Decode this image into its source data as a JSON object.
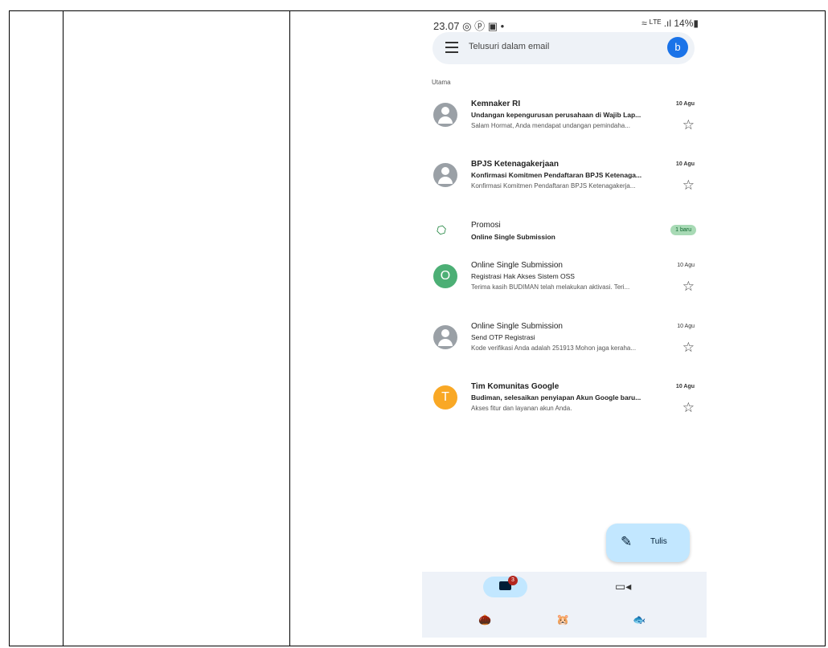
{
  "status": {
    "time": "23.07",
    "left_icons": "◎ ⓟ ▣ •",
    "right_info": "≈ ᴸᵀᴱ .ıl 14%▮"
  },
  "search": {
    "placeholder": "Telusuri dalam email",
    "avatar_letter": "b"
  },
  "section_label": "Utama",
  "emails": [
    {
      "sender": "Kemnaker RI",
      "date": "10 Agu",
      "subject": "Undangan kepengurusan perusahaan di Wajib Lap...",
      "snippet": "Salam Hormat, Anda mendapat undangan pemindaha...",
      "unread": true,
      "avatar_color": "#9aa0a6"
    },
    {
      "sender": "BPJS Ketenagakerjaan",
      "date": "10 Agu",
      "subject": "Konfirmasi Komitmen Pendaftaran BPJS Ketenaga...",
      "snippet": "Konfirmasi Komitmen Pendaftaran BPJS Ketenagakerja...",
      "unread": true,
      "avatar_color": "#9aa0a6"
    },
    {
      "sender": "Online Single Submission",
      "date": "10 Agu",
      "subject": "Registrasi Hak Akses Sistem OSS",
      "snippet": "Terima kasih BUDIMAN telah melakukan aktivasi. Teri...",
      "unread": false,
      "avatar_color": "#4caf75",
      "avatar_letter": "O"
    },
    {
      "sender": "Online Single Submission",
      "date": "10 Agu",
      "subject": "Send OTP Registrasi",
      "snippet": "Kode verifikasi Anda adalah 251913 Mohon jaga keraha...",
      "unread": false,
      "avatar_color": "#9aa0a6"
    },
    {
      "sender": "Tim Komunitas Google",
      "date": "10 Agu",
      "subject": "Budiman, selesaikan penyiapan Akun Google baru...",
      "snippet": "Akses fitur dan layanan akun Anda.",
      "unread": true,
      "avatar_color": "#f9a825",
      "avatar_letter": "T"
    }
  ],
  "promo": {
    "title": "Promosi",
    "subtitle": "Online Single Submission",
    "badge": "1 baru"
  },
  "fab": {
    "label": "Tulis"
  },
  "nav": {
    "mail_badge": "3"
  },
  "colors": {
    "accent": "#1a73e8",
    "fab_bg": "#c2e7ff",
    "badge_red": "#b3261e",
    "promo_green": "#a8dab5"
  },
  "icons": {
    "menu": "menu-icon",
    "star": "star-icon",
    "tag": "tag-icon",
    "pencil": "pencil-icon",
    "mail": "mail-icon",
    "video": "video-icon"
  }
}
